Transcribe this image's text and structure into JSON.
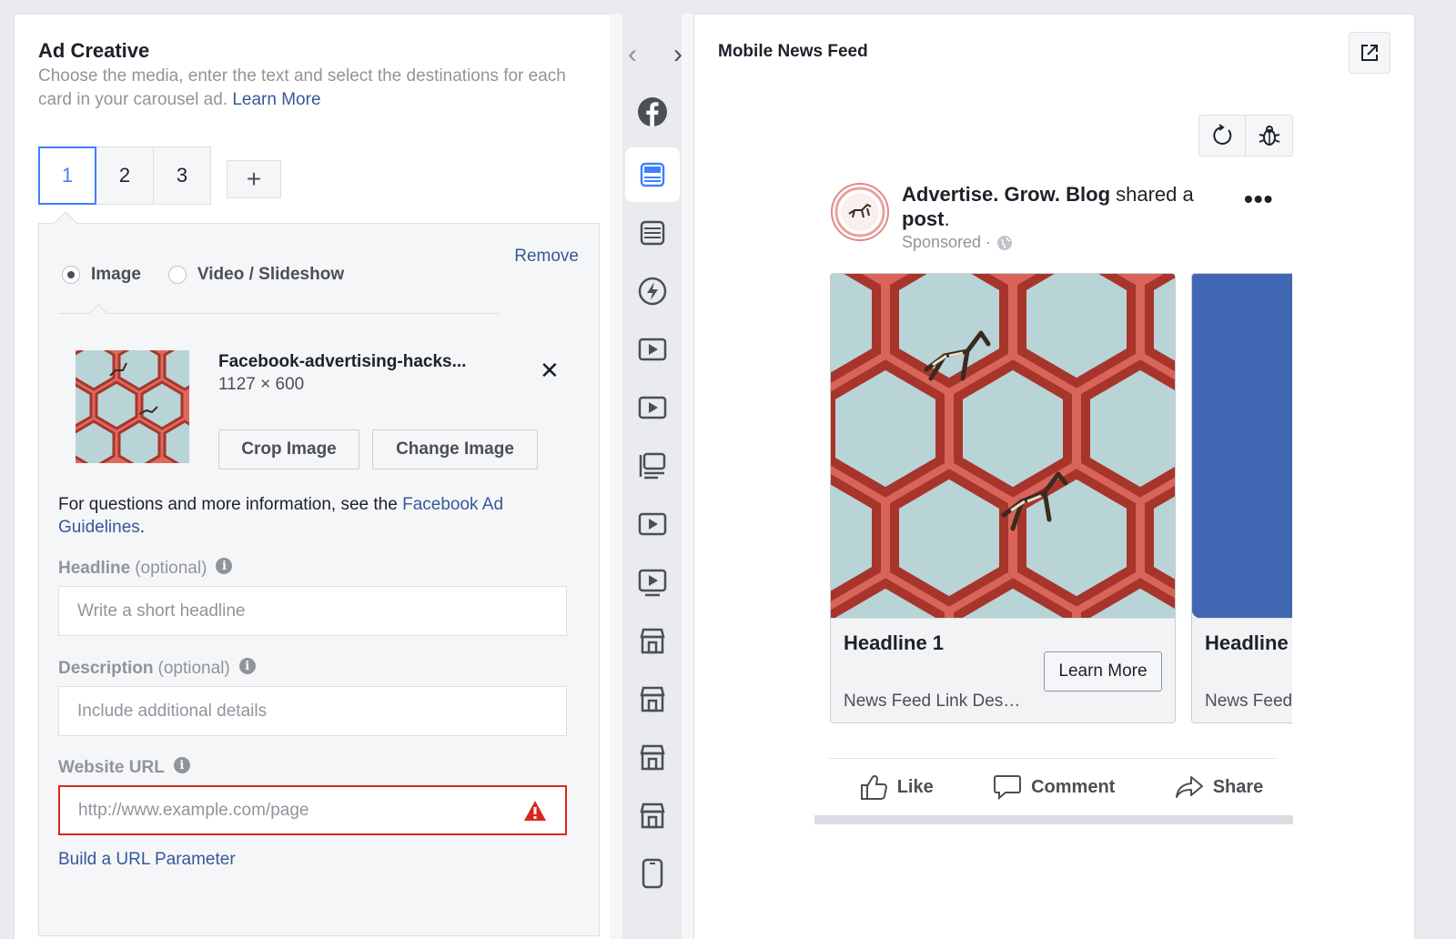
{
  "editor": {
    "title": "Ad Creative",
    "subtitle": "Choose the media, enter the text and select the destinations for each card in your carousel ad.",
    "learn_more": "Learn More",
    "card_tabs": [
      "1",
      "2",
      "3"
    ],
    "add_card": "+",
    "remove": "Remove",
    "media_options": [
      "Image",
      "Video / Slideshow"
    ],
    "selected_media": "Image",
    "file": {
      "name": "Facebook-advertising-hacks...",
      "dims": "1127 × 600"
    },
    "crop_button": "Crop Image",
    "change_button": "Change Image",
    "info_prefix": "For questions and more information, see the ",
    "info_link": "Facebook Ad Guidelines",
    "info_suffix": ".",
    "fields": {
      "headline": {
        "label": "Headline",
        "optional": "(optional)",
        "placeholder": "Write a short headline"
      },
      "description": {
        "label": "Description",
        "optional": "(optional)",
        "placeholder": "Include additional details"
      },
      "url": {
        "label": "Website URL",
        "placeholder": "http://www.example.com/page"
      }
    },
    "url_param": "Build a URL Parameter"
  },
  "preview": {
    "title": "Mobile News Feed",
    "page_name": "Advertise. Grow. Blog",
    "shared_text": " shared a ",
    "post_word": "post",
    "period": ".",
    "sponsored": "Sponsored ·",
    "more": "•••",
    "cards": [
      {
        "headline": "Headline 1",
        "description": "News Feed Link Des…",
        "cta": "Learn More"
      },
      {
        "headline": "Headline",
        "description": "News Feed"
      }
    ],
    "actions": {
      "like": "Like",
      "comment": "Comment",
      "share": "Share"
    }
  },
  "rail": {
    "nav_prev": "‹",
    "nav_next": "›",
    "icons": [
      "facebook-icon",
      "feed-placement-icon",
      "feed-alt-icon",
      "instant-article-icon",
      "video-icon",
      "video-alt-icon",
      "list-icon",
      "in-stream-video-icon",
      "suggested-video-icon",
      "marketplace-icon",
      "marketplace-alt-icon",
      "store-icon",
      "store-alt-icon",
      "mobile-icon"
    ]
  },
  "colors": {
    "accent": "#4080ff",
    "link": "#365899",
    "error": "#d8281e",
    "fb_blue": "#4267b2"
  }
}
